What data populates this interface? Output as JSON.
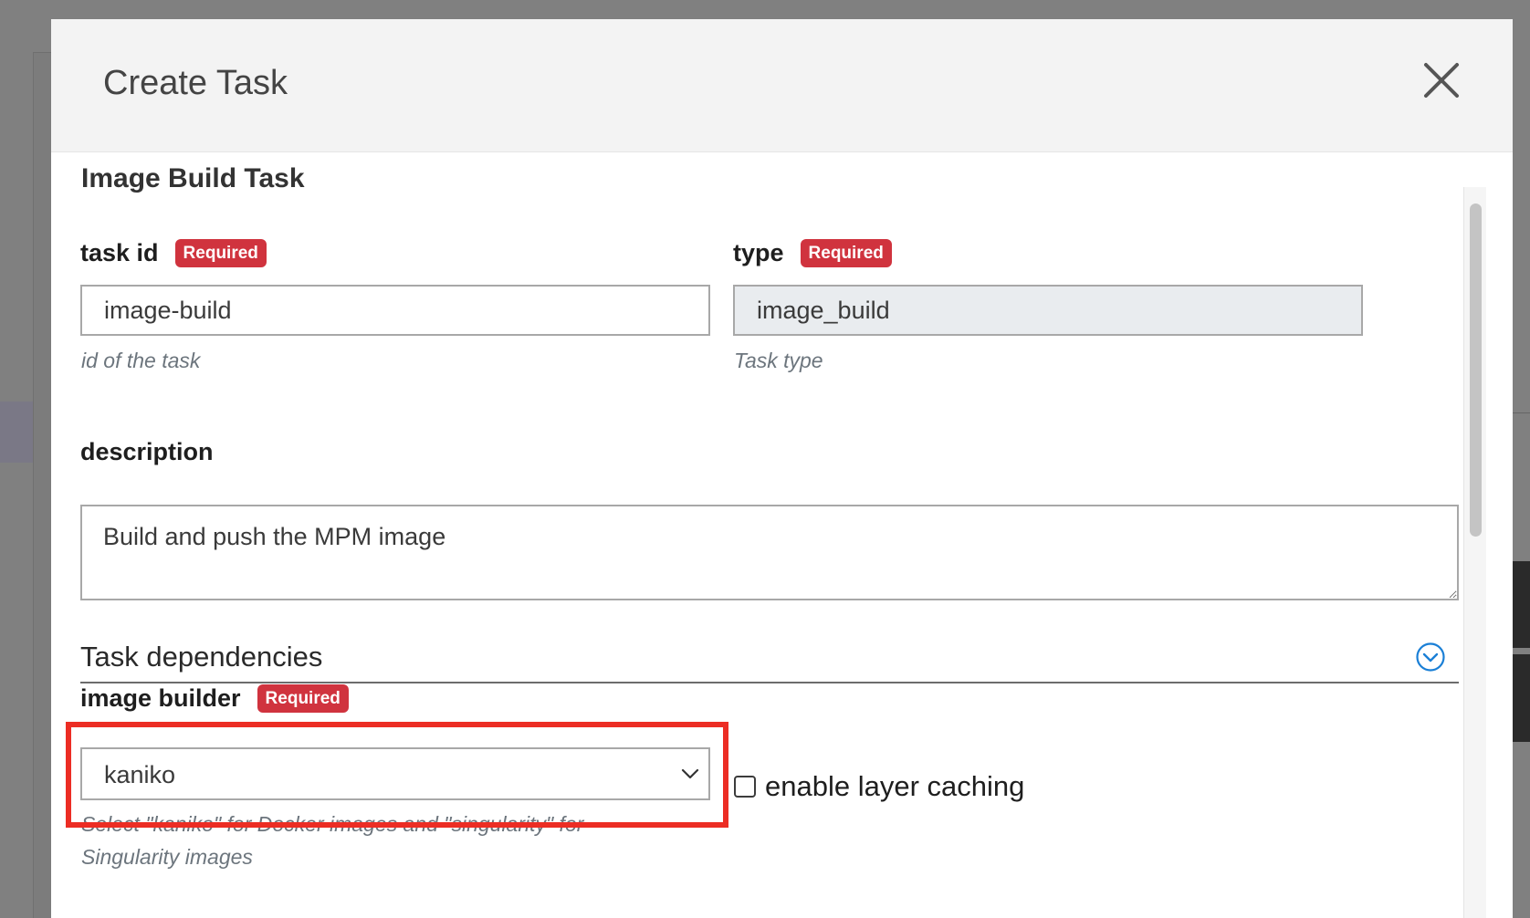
{
  "modal": {
    "title": "Create Task",
    "close_icon": "close-icon",
    "section_heading": "Image Build Task"
  },
  "fields": {
    "task_id": {
      "label": "task id",
      "badge": "Required",
      "value": "image-build",
      "help": "id of the task"
    },
    "type": {
      "label": "type",
      "badge": "Required",
      "value": "image_build",
      "help": "Task type"
    },
    "description": {
      "label": "description",
      "value": "Build and push the MPM image"
    },
    "task_dependencies": {
      "title": "Task dependencies",
      "icon": "chevron-down-circle-icon"
    },
    "image_builder": {
      "label": "image builder",
      "badge": "Required",
      "value": "kaniko",
      "help_line1": "Select \"kaniko\" for Docker images and \"singularity\" for",
      "help_line2": "Singularity images"
    },
    "layer_caching": {
      "label": "enable layer caching",
      "checked": false
    }
  },
  "colors": {
    "badge": "#d0333e",
    "highlight": "#ec2d24",
    "accent": "#1a7fd6"
  }
}
